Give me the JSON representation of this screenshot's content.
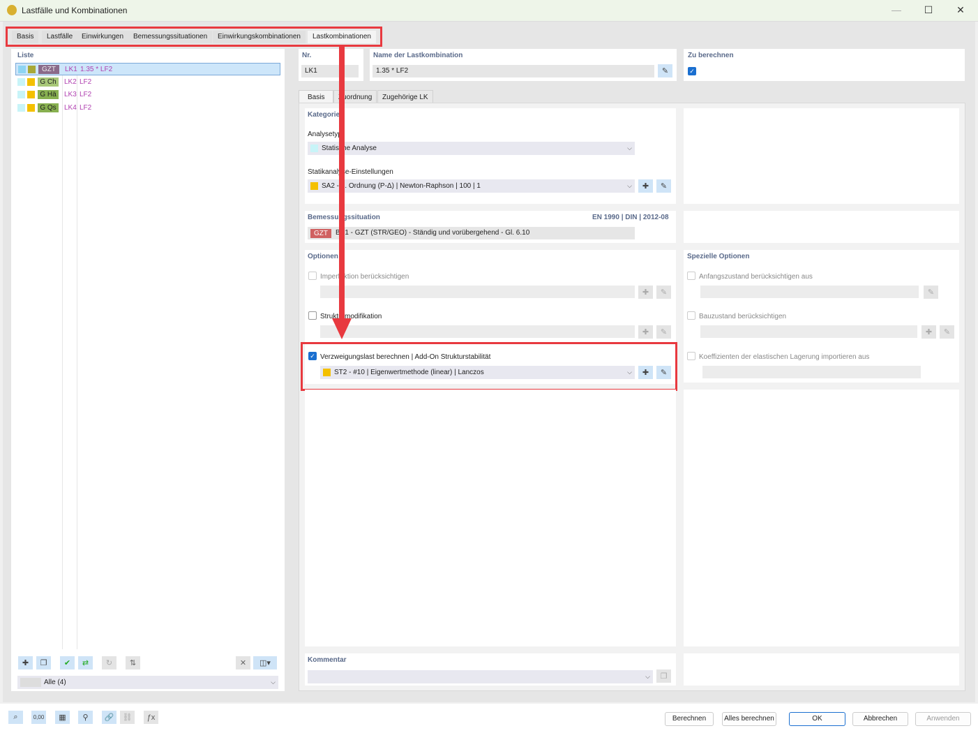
{
  "window": {
    "title": "Lastfälle und Kombinationen",
    "icon": "app-icon"
  },
  "tabs": [
    "Basis",
    "Lastfälle",
    "Einwirkungen",
    "Bemessungssituationen",
    "Einwirkungskombinationen",
    "Lastkombinationen"
  ],
  "active_tab": "Lastkombinationen",
  "list": {
    "header": "Liste",
    "items": [
      {
        "badge": "GZT",
        "badge_color": "#8a6a8a",
        "color1": "#8ed4f2",
        "color2": "#a8a838",
        "no": "LK1",
        "name": "1.35 * LF2",
        "selected": true
      },
      {
        "badge": "G Ch",
        "badge_color": "#a8c878",
        "color1": "#c8f4f8",
        "color2": "#f4c000",
        "no": "LK2",
        "name": "LF2"
      },
      {
        "badge": "G Hä",
        "badge_color": "#88b050",
        "color1": "#c8f4f8",
        "color2": "#f4c000",
        "no": "LK3",
        "name": "LF2"
      },
      {
        "badge": "G Qs",
        "badge_color": "#88b050",
        "color1": "#c8f4f8",
        "color2": "#f4c000",
        "no": "LK4",
        "name": "LF2"
      }
    ],
    "filter": "Alle (4)"
  },
  "header": {
    "nr_label": "Nr.",
    "nr_value": "LK1",
    "name_label": "Name der Lastkombination",
    "name_value": "1.35 * LF2",
    "calc_label": "Zu berechnen",
    "calc_checked": true
  },
  "subtabs": [
    "Basis",
    "Zuordnung",
    "Zugehörige LK"
  ],
  "kategorie": {
    "title": "Kategorie",
    "analysis_label": "Analysetyp",
    "analysis_value": "Statische Analyse",
    "settings_label": "Statikanalyse-Einstellungen",
    "settings_value": "SA2 - II. Ordnung (P-Δ) | Newton-Raphson | 100 | 1"
  },
  "design": {
    "title": "Bemessungssituation",
    "norm": "EN 1990 | DIN | 2012-08",
    "badge": "GZT",
    "value": "BS1 - GZT (STR/GEO) - Ständig und vorübergehend - Gl. 6.10"
  },
  "options": {
    "title": "Optionen",
    "imperfection": "Imperfektion berücksichtigen",
    "structure_mod": "Strukturmodifikation",
    "stability": "Verzweigungslast berechnen | Add-On Strukturstabilität",
    "stability_checked": true,
    "stability_value": "ST2 - #10 | Eigenwertmethode (linear) | Lanczos"
  },
  "special": {
    "title": "Spezielle Optionen",
    "initial": "Anfangszustand berücksichtigen aus",
    "construction": "Bauzustand berücksichtigen",
    "coeff": "Koeffizienten der elastischen Lagerung importieren aus"
  },
  "comment": {
    "title": "Kommentar"
  },
  "buttons": {
    "calc": "Berechnen",
    "calc_all": "Alles berechnen",
    "ok": "OK",
    "cancel": "Abbrechen",
    "apply": "Anwenden"
  },
  "colors": {
    "highlight": "#e8393f",
    "accent": "#1a6fd0"
  }
}
